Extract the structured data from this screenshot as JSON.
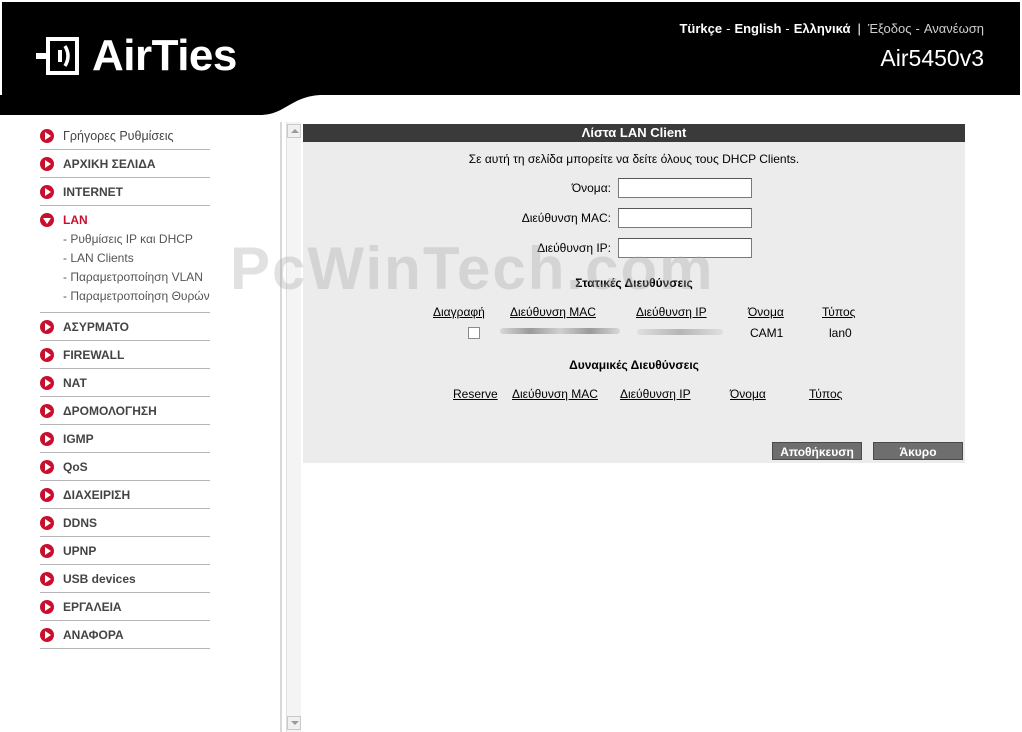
{
  "header": {
    "brand": "AirTies",
    "languages": [
      "Türkçe",
      "English",
      "Ελληνικά"
    ],
    "logout_label": "Έξοδος",
    "refresh_label": "Ανανέωση",
    "model": "Air5450v3"
  },
  "sidebar": {
    "items": [
      {
        "label": "Γρήγορες Ρυθμίσεις"
      },
      {
        "label": "ΑΡΧΙΚΗ ΣΕΛΙΔΑ"
      },
      {
        "label": "INTERNET"
      },
      {
        "label": "LAN",
        "active": true,
        "children": [
          "- Ρυθμίσεις IP και DHCP",
          "- LAN Clients",
          "- Παραμετροποίηση VLAN",
          "- Παραμετροποίηση Θυρών"
        ]
      },
      {
        "label": "ΑΣΥΡΜΑΤΟ"
      },
      {
        "label": "FIREWALL"
      },
      {
        "label": "NAT"
      },
      {
        "label": "ΔΡΟΜΟΛΟΓΗΣΗ"
      },
      {
        "label": "IGMP"
      },
      {
        "label": "QoS"
      },
      {
        "label": "ΔΙΑΧΕΙΡΙΣΗ"
      },
      {
        "label": "DDNS"
      },
      {
        "label": "UPNP"
      },
      {
        "label": "USB devices"
      },
      {
        "label": "ΕΡΓΑΛΕΙΑ"
      },
      {
        "label": "ΑΝΑΦΟΡΑ"
      }
    ]
  },
  "panel": {
    "title": "Λίστα LAN Client",
    "intro": "Σε αυτή τη σελίδα μπορείτε να δείτε όλους τους DHCP Clients.",
    "fields": [
      {
        "label": "Όνομα:",
        "value": ""
      },
      {
        "label": "Διεύθυνση MAC:",
        "value": ""
      },
      {
        "label": "Διεύθυνση IP:",
        "value": ""
      }
    ],
    "static_title": "Στατικές Διευθύνσεις",
    "static_columns": [
      "Διαγραφή",
      "Διεύθυνση MAC",
      "Διεύθυνση IP",
      "Όνομα",
      "Τύπος"
    ],
    "static_rows": [
      {
        "delete": false,
        "mac": "",
        "ip": "",
        "name": "CAM1",
        "type": "lan0"
      }
    ],
    "dynamic_title": "Δυναμικές Διευθύνσεις",
    "dynamic_columns": [
      "Reserve",
      "Διεύθυνση MAC",
      "Διεύθυνση IP",
      "Όνομα",
      "Τύπος"
    ],
    "save_label": "Αποθήκευση",
    "cancel_label": "Άκυρο"
  },
  "watermark": "PcWinTech.com",
  "colors": {
    "accent": "#c8102e",
    "header_bg": "#000000",
    "panel_bg": "#ececec",
    "title_bar": "#3a3a3a",
    "button": "#6e6e6e"
  }
}
